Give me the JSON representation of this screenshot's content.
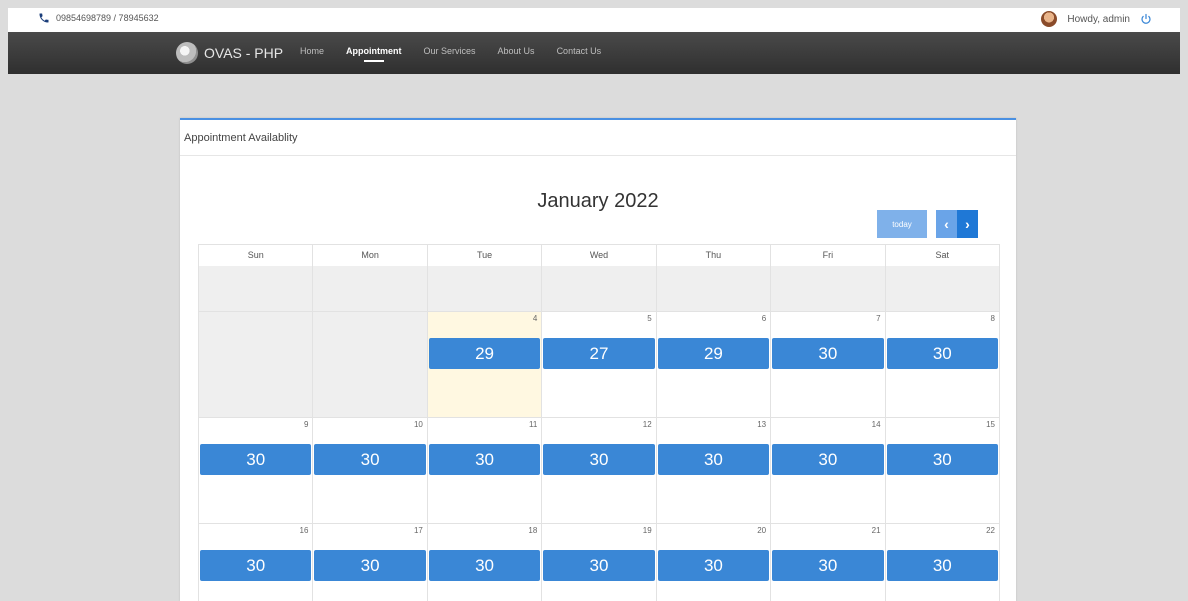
{
  "topbar": {
    "phone_icon": "phone-icon",
    "phone": "09854698789 / 78945632",
    "user_greeting": "Howdy, admin",
    "power_icon": "power-icon"
  },
  "navbar": {
    "brand": "OVAS - PHP",
    "items": [
      {
        "label": "Home",
        "active": false
      },
      {
        "label": "Appointment",
        "active": true
      },
      {
        "label": "Our Services",
        "active": false
      },
      {
        "label": "About Us",
        "active": false
      },
      {
        "label": "Contact Us",
        "active": false
      }
    ]
  },
  "card": {
    "title": "Appointment Availablity"
  },
  "calendar": {
    "title": "January 2022",
    "today_label": "today",
    "prev_icon": "chevron-left-icon",
    "next_icon": "chevron-right-icon",
    "prev_symbol": "‹",
    "next_symbol": "›",
    "weekdays": [
      "Sun",
      "Mon",
      "Tue",
      "Wed",
      "Thu",
      "Fri",
      "Sat"
    ],
    "weeks": [
      {
        "days": [
          {
            "num": "",
            "other": true
          },
          {
            "num": "",
            "other": true
          },
          {
            "num": "",
            "other": true
          },
          {
            "num": "",
            "other": true
          },
          {
            "num": "",
            "other": true
          },
          {
            "num": "",
            "other": true
          },
          {
            "num": "",
            "other": true
          }
        ]
      },
      {
        "days": [
          {
            "num": "",
            "other": true
          },
          {
            "num": "",
            "other": true
          },
          {
            "num": "4",
            "today": true,
            "event": "29"
          },
          {
            "num": "5",
            "event": "27"
          },
          {
            "num": "6",
            "event": "29"
          },
          {
            "num": "7",
            "event": "30"
          },
          {
            "num": "8",
            "event": "30"
          }
        ]
      },
      {
        "days": [
          {
            "num": "9",
            "event": "30"
          },
          {
            "num": "10",
            "event": "30"
          },
          {
            "num": "11",
            "event": "30"
          },
          {
            "num": "12",
            "event": "30"
          },
          {
            "num": "13",
            "event": "30"
          },
          {
            "num": "14",
            "event": "30"
          },
          {
            "num": "15",
            "event": "30"
          }
        ]
      },
      {
        "days": [
          {
            "num": "16",
            "event": "30"
          },
          {
            "num": "17",
            "event": "30"
          },
          {
            "num": "18",
            "event": "30"
          },
          {
            "num": "19",
            "event": "30"
          },
          {
            "num": "20",
            "event": "30"
          },
          {
            "num": "21",
            "event": "30"
          },
          {
            "num": "22",
            "event": "30"
          }
        ]
      }
    ]
  },
  "colors": {
    "accent": "#3a87d6",
    "today_bg": "#fff8e1",
    "navbar_bg": "#333333"
  }
}
